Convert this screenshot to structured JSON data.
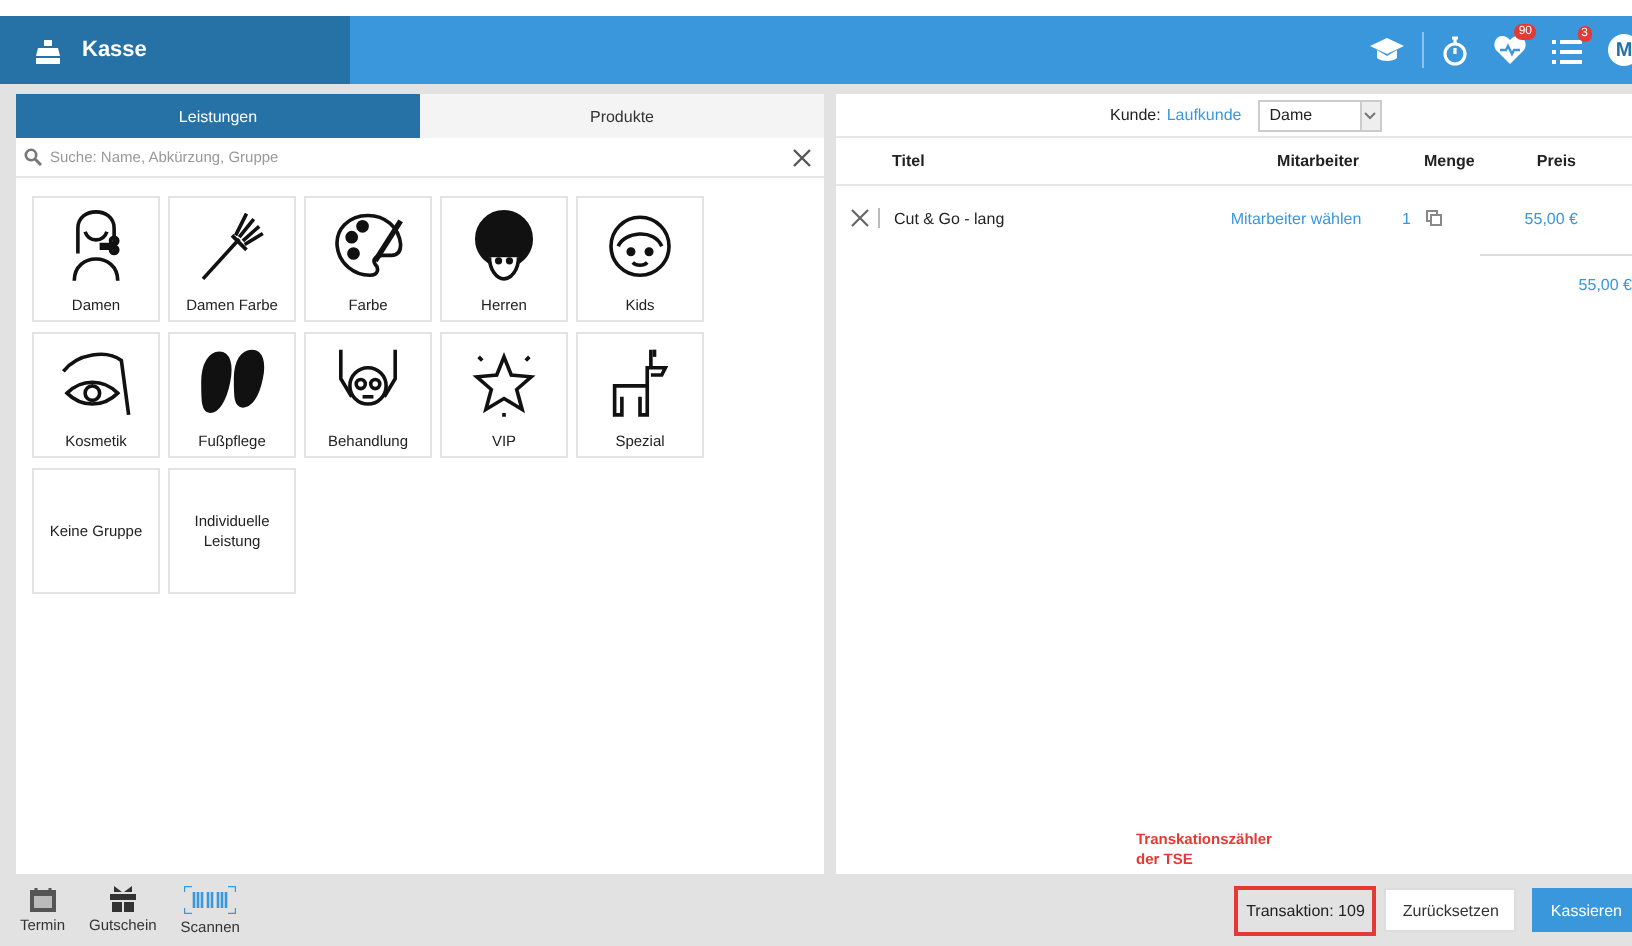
{
  "header": {
    "title": "Kasse",
    "icons": [
      {
        "kind": "cap"
      },
      {
        "kind": "stopwatch"
      },
      {
        "kind": "heart",
        "badge": "90"
      },
      {
        "kind": "list",
        "badge": "3"
      },
      {
        "kind": "avatar",
        "initial": "M"
      }
    ]
  },
  "tabs": [
    {
      "label": "Leistungen",
      "selected": true
    },
    {
      "label": "Produkte",
      "selected": false
    }
  ],
  "search": {
    "placeholder": "Suche: Name, Abkürzung, Gruppe"
  },
  "categories": [
    {
      "label": "Damen",
      "kind": "woman"
    },
    {
      "label": "Damen Farbe",
      "kind": "brush"
    },
    {
      "label": "Farbe",
      "kind": "palette"
    },
    {
      "label": "Herren",
      "kind": "man"
    },
    {
      "label": "Kids",
      "kind": "child"
    },
    {
      "label": "Kosmetik",
      "kind": "eye"
    },
    {
      "label": "Fußpflege",
      "kind": "flipflops"
    },
    {
      "label": "Behandlung",
      "kind": "facial"
    },
    {
      "label": "VIP",
      "kind": "star"
    },
    {
      "label": "Spezial",
      "kind": "llama"
    },
    {
      "label": "Keine Gruppe",
      "kind": "text"
    },
    {
      "label": "Individuelle Leistung",
      "kind": "text"
    }
  ],
  "customer": {
    "label": "Kunde:",
    "name": "Laufkunde",
    "select": "Dame"
  },
  "table": {
    "columns": [
      "Titel",
      "Mitarbeiter",
      "Menge",
      "Preis"
    ],
    "rows": [
      {
        "title": "Cut & Go - lang",
        "employee": "Mitarbeiter wählen",
        "quantity": "1",
        "price": "55,00 €"
      }
    ],
    "total": "55,00 €"
  },
  "annotation": "Transkationszähler der TSE",
  "transaction": {
    "text": "Transaktion: 109",
    "highlighted": true
  },
  "buttons": [
    {
      "label": "Zurücksetzen",
      "kind": "plain"
    },
    {
      "label": "Kassieren",
      "kind": "primary"
    }
  ],
  "toolbar": [
    {
      "label": "Termin",
      "kind": "calendar"
    },
    {
      "label": "Gutschein",
      "kind": "gift"
    },
    {
      "label": "Scannen",
      "kind": "barcode"
    }
  ]
}
